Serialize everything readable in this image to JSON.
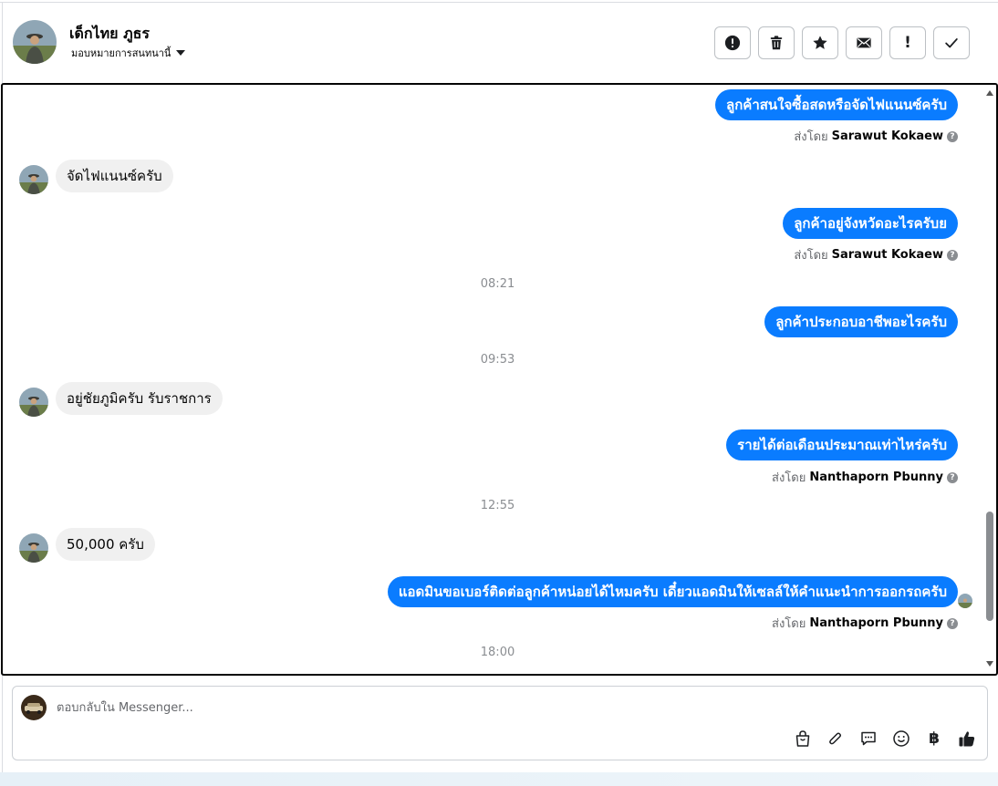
{
  "header": {
    "contact_name": "เด็กไทย ภูธร",
    "assign_label": "มอบหมายการสนทนานี้",
    "actions": [
      {
        "icon": "alert-circle-icon",
        "label": "Mark as spam"
      },
      {
        "icon": "trash-icon",
        "label": "Delete"
      },
      {
        "icon": "star-icon",
        "label": "Follow up"
      },
      {
        "icon": "envelope-icon",
        "label": "Mark as unread"
      },
      {
        "icon": "exclamation-icon",
        "label": "!"
      },
      {
        "icon": "check-icon",
        "label": "Done"
      }
    ]
  },
  "messages": {
    "m1": "ลูกค้าสนใจซื้อสดหรือจัดไฟแนนซ์ครับ",
    "m1_prefix": "ส่งโดย",
    "m1_sender": "Sarawut Kokaew",
    "m2": "จัดไฟแนนซ์ครับ",
    "m3": "ลูกค้าอยู่จังหวัดอะไรครับย",
    "m3_prefix": "ส่งโดย",
    "m3_sender": "Sarawut Kokaew",
    "t1": "08:21",
    "m4": "ลูกค้าประกอบอาชีพอะไรครับ",
    "t2": "09:53",
    "m5": "อยู่ชัยภูมิครับ รับราชการ",
    "m6": "รายได้ต่อเดือนประมาณเท่าไหร่ครับ",
    "m6_prefix": "ส่งโดย",
    "m6_sender": "Nanthaporn Pbunny",
    "t3": "12:55",
    "m7": "50,000 ครับ",
    "m8": "แอดมินขอเบอร์ติดต่อลูกค้าหน่อยได้ไหมครับ เดี๋ยวแอดมินให้เซลล์ให้คำแนะนำการออกรถครับ",
    "m8_prefix": "ส่งโดย",
    "m8_sender": "Nanthaporn Pbunny",
    "t4": "18:00"
  },
  "composer": {
    "placeholder": "ตอบกลับใน Messenger...",
    "tools": [
      "shopping-bag-icon",
      "paperclip-icon",
      "saved-reply-icon",
      "emoji-icon",
      "baht-icon",
      "thumbs-up-icon"
    ],
    "baht_symbol": "฿"
  },
  "colors": {
    "outgoing_bubble": "#0a7cff",
    "incoming_bubble": "#f0f0f0",
    "timestamp": "#8a8d91"
  }
}
